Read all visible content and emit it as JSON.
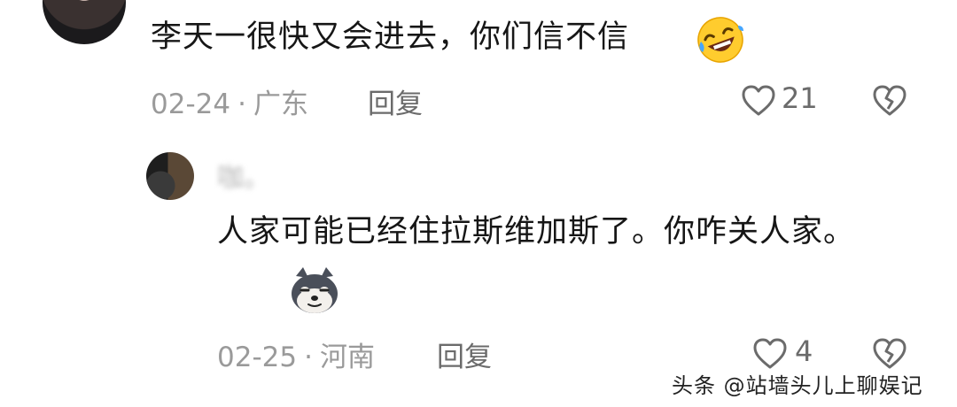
{
  "comments": [
    {
      "text": "李天一很快又会进去，你们信不信",
      "emoji": "rolling-on-floor-laughing-emoji",
      "date": "02-24",
      "location": "广东",
      "reply_label": "回复",
      "likes": "21"
    },
    {
      "author": "咖。",
      "text": "人家可能已经住拉斯维加斯了。你咋关人家。",
      "emoji": "doge-emoji",
      "date": "02-25",
      "location": "河南",
      "reply_label": "回复",
      "likes": "4"
    }
  ],
  "separator": "·",
  "watermark": "头条 @站墙头儿上聊娱记",
  "icons": {
    "like": "heart-outline-icon",
    "dislike": "broken-heart-icon"
  },
  "colors": {
    "text": "#161616",
    "meta": "#9a9a9a",
    "icon": "#6b6b6b"
  }
}
